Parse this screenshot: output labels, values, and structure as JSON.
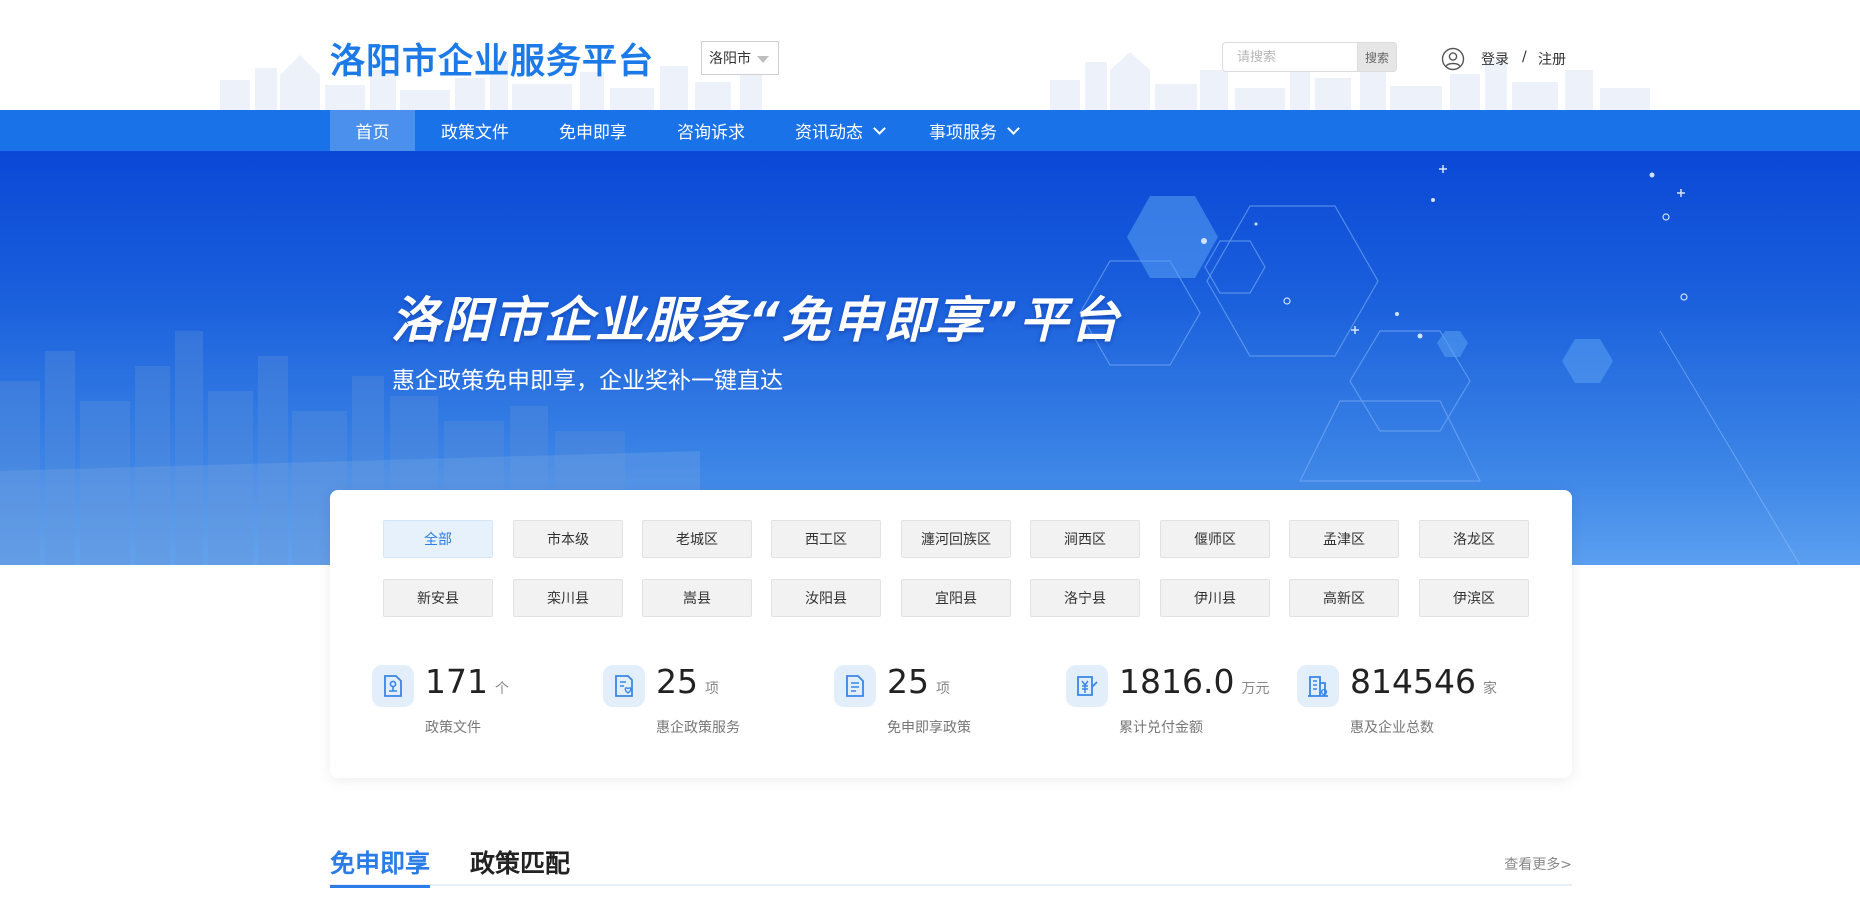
{
  "header": {
    "logo": "洛阳市企业服务平台",
    "city_select": "洛阳市",
    "search_placeholder": "请搜索",
    "search_button": "搜索",
    "login": "登录",
    "separator": "/",
    "register": "注册"
  },
  "nav": {
    "items": [
      {
        "label": "首页",
        "active": true
      },
      {
        "label": "政策文件"
      },
      {
        "label": "免申即享"
      },
      {
        "label": "咨询诉求"
      },
      {
        "label": "资讯动态",
        "dropdown": true
      },
      {
        "label": "事项服务",
        "dropdown": true
      }
    ]
  },
  "banner": {
    "title": "洛阳市企业服务“免申即享”平台",
    "subtitle": "惠企政策免申即享，企业奖补一键直达"
  },
  "districts": {
    "row1": [
      "全部",
      "市本级",
      "老城区",
      "西工区",
      "瀍河回族区",
      "涧西区",
      "偃师区",
      "孟津区",
      "洛龙区"
    ],
    "row2": [
      "新安县",
      "栾川县",
      "嵩县",
      "汝阳县",
      "宜阳县",
      "洛宁县",
      "伊川县",
      "高新区",
      "伊滨区"
    ],
    "selected": "全部"
  },
  "stats": [
    {
      "value": "171",
      "unit": "个",
      "label": "政策文件",
      "icon": "policy-document-icon"
    },
    {
      "value": "25",
      "unit": "项",
      "label": "惠企政策服务",
      "icon": "heart-document-icon"
    },
    {
      "value": "25",
      "unit": "项",
      "label": "免申即享政策",
      "icon": "list-document-icon"
    },
    {
      "value": "1816.0",
      "unit": "万元",
      "label": "累计兑付金额",
      "icon": "yuan-payment-icon"
    },
    {
      "value": "814546",
      "unit": "家",
      "label": "惠及企业总数",
      "icon": "enterprise-building-icon"
    }
  ],
  "tabs": {
    "items": [
      "免申即享",
      "政策匹配"
    ],
    "active": "免申即享",
    "more": "查看更多>"
  },
  "colors": {
    "brand": "#1b7ae8",
    "nav": "#1a72e8",
    "nav_active": "#4a90ec",
    "accent": "#2a7ce6"
  }
}
